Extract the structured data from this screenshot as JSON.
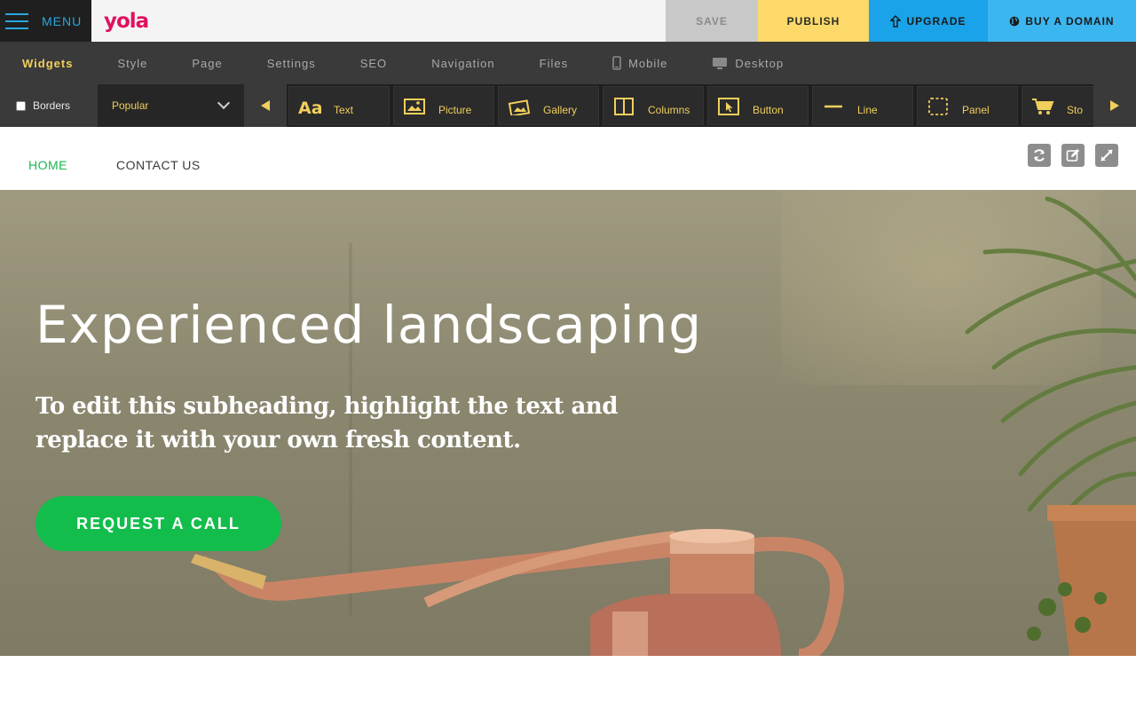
{
  "topbar": {
    "menu_label": "MENU",
    "logo": "yola",
    "save_label": "SAVE",
    "publish_label": "PUBLISH",
    "upgrade_label": "UPGRADE",
    "domain_label": "BUY A DOMAIN",
    "colors": {
      "save": "#c8c8c8",
      "publish": "#fdd969",
      "upgrade": "#1aa3e8",
      "domain": "#3bb6ef",
      "menu_accent": "#29a7df",
      "logo": "#e0115f"
    }
  },
  "tabs": [
    {
      "label": "Widgets",
      "active": true
    },
    {
      "label": "Style"
    },
    {
      "label": "Page"
    },
    {
      "label": "Settings"
    },
    {
      "label": "SEO"
    },
    {
      "label": "Navigation"
    },
    {
      "label": "Files"
    },
    {
      "label": "Mobile",
      "icon": "mobile-icon"
    },
    {
      "label": "Desktop",
      "icon": "desktop-icon"
    }
  ],
  "widgetbar": {
    "borders_label": "Borders",
    "borders_checked": false,
    "category": "Popular",
    "widgets": [
      {
        "label": "Text",
        "icon": "text-icon"
      },
      {
        "label": "Picture",
        "icon": "picture-icon"
      },
      {
        "label": "Gallery",
        "icon": "gallery-icon"
      },
      {
        "label": "Columns",
        "icon": "columns-icon"
      },
      {
        "label": "Button",
        "icon": "button-icon"
      },
      {
        "label": "Line",
        "icon": "line-icon"
      },
      {
        "label": "Panel",
        "icon": "panel-icon"
      },
      {
        "label": "Sto",
        "icon": "cart-icon"
      }
    ]
  },
  "site": {
    "nav": [
      {
        "label": "HOME",
        "active": true
      },
      {
        "label": "CONTACT US"
      }
    ],
    "hero": {
      "title": "Experienced landscaping",
      "subtitle": "To edit this subheading, highlight the text and replace it with your own fresh content.",
      "cta": "REQUEST A CALL"
    },
    "accent": "#1bb74f"
  }
}
